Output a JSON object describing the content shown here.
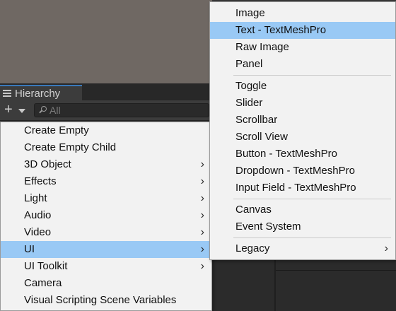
{
  "hierarchy": {
    "tab_label": "Hierarchy",
    "search_placeholder": "All"
  },
  "create_menu": {
    "items": [
      {
        "label": "Create Empty"
      },
      {
        "label": "Create Empty Child"
      },
      {
        "label": "3D Object",
        "submenu": true
      },
      {
        "label": "Effects",
        "submenu": true
      },
      {
        "label": "Light",
        "submenu": true
      },
      {
        "label": "Audio",
        "submenu": true
      },
      {
        "label": "Video",
        "submenu": true
      },
      {
        "label": "UI",
        "submenu": true,
        "selected": true
      },
      {
        "label": "UI Toolkit",
        "submenu": true
      },
      {
        "label": "Camera"
      },
      {
        "label": "Visual Scripting Scene Variables"
      }
    ]
  },
  "ui_submenu": {
    "group1": [
      "Image",
      "Text - TextMeshPro",
      "Raw Image",
      "Panel"
    ],
    "group2": [
      "Toggle",
      "Slider",
      "Scrollbar",
      "Scroll View",
      "Button - TextMeshPro",
      "Dropdown - TextMeshPro",
      "Input Field - TextMeshPro"
    ],
    "group3": [
      "Canvas",
      "Event System"
    ],
    "group4": [
      "Legacy"
    ],
    "highlighted": "Text - TextMeshPro"
  },
  "colors": {
    "highlight": "#99c9f5",
    "menu_bg": "#f2f2f2",
    "scene_bg": "#6f6863",
    "tab_accent": "#3a79bb"
  },
  "icons": {
    "submenu_arrow": "›",
    "add": "+"
  }
}
